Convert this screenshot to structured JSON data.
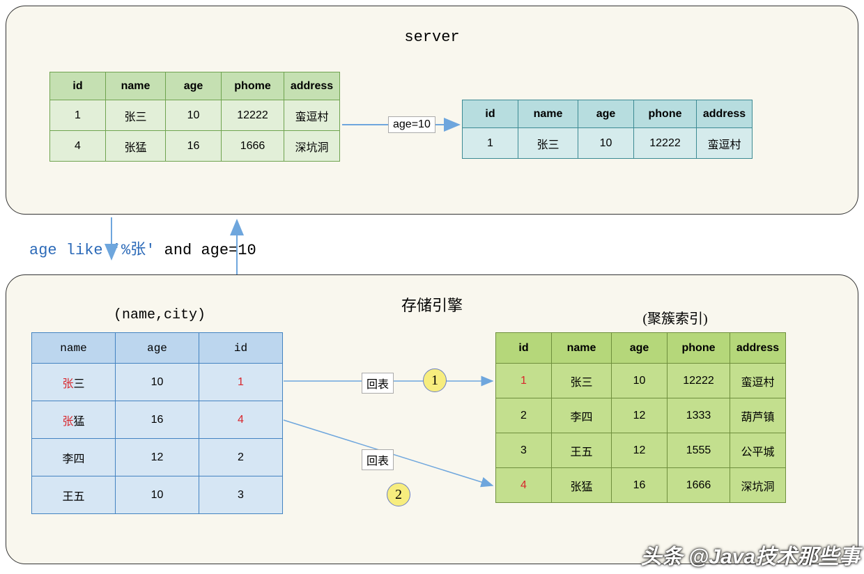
{
  "top": {
    "title": "server",
    "arrow_label": "age=10",
    "left_table": {
      "headers": [
        "id",
        "name",
        "age",
        "phome",
        "address"
      ],
      "rows": [
        {
          "id": "1",
          "name": "张三",
          "age": "10",
          "phone": "12222",
          "address": "蛮逗村"
        },
        {
          "id": "4",
          "name": "张猛",
          "age": "16",
          "phone": "1666",
          "address": "深坑洞"
        }
      ]
    },
    "right_table": {
      "headers": [
        "id",
        "name",
        "age",
        "phone",
        "address"
      ],
      "row": {
        "id": "1",
        "name": "张三",
        "age": "10",
        "phone": "12222",
        "address": "蛮逗村"
      }
    }
  },
  "middle": {
    "part1": "age like '%张'",
    "part2": " and age=10"
  },
  "bottom": {
    "title": "存储引擎",
    "left_label": "(name,city)",
    "right_label": "(聚簇索引)",
    "lookup_label": "回表",
    "marker1": "1",
    "marker2": "2",
    "left_table": {
      "headers": [
        "name",
        "age",
        "id"
      ],
      "rows": [
        {
          "name_red": "张",
          "name_black": "三",
          "age": "10",
          "id": "1",
          "id_red": true
        },
        {
          "name_red": "张",
          "name_black": "猛",
          "age": "16",
          "id": "4",
          "id_red": true
        },
        {
          "name_red": "",
          "name_black": "李四",
          "age": "12",
          "id": "2",
          "id_red": false
        },
        {
          "name_red": "",
          "name_black": "王五",
          "age": "10",
          "id": "3",
          "id_red": false
        }
      ]
    },
    "right_table": {
      "headers": [
        "id",
        "name",
        "age",
        "phone",
        "address"
      ],
      "rows": [
        {
          "id": "1",
          "id_red": true,
          "name": "张三",
          "age": "10",
          "phone": "12222",
          "address": "蛮逗村"
        },
        {
          "id": "2",
          "id_red": false,
          "name": "李四",
          "age": "12",
          "phone": "1333",
          "address": "葫芦镇"
        },
        {
          "id": "3",
          "id_red": false,
          "name": "王五",
          "age": "12",
          "phone": "1555",
          "address": "公平城"
        },
        {
          "id": "4",
          "id_red": true,
          "name": "张猛",
          "age": "16",
          "phone": "1666",
          "address": "深坑洞"
        }
      ]
    }
  },
  "watermark": "头条 @Java技术那些事"
}
